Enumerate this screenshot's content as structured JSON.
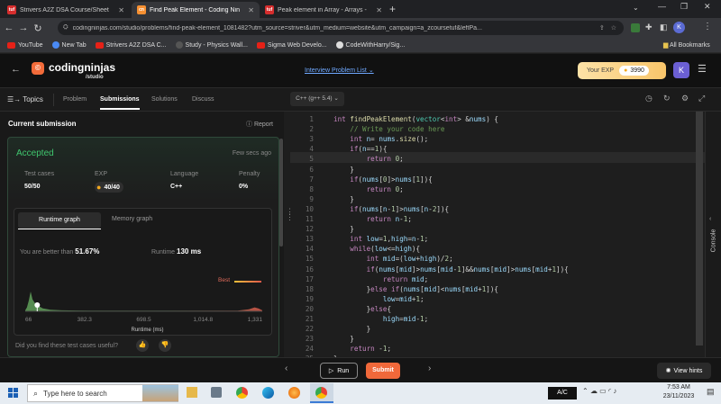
{
  "browser": {
    "tabs": [
      {
        "fav": "tuf",
        "title": "Strivers A2Z DSA Course/Sheet",
        "active": false
      },
      {
        "fav": "cn",
        "title": "Find Peak Element - Coding Nin",
        "active": true
      },
      {
        "fav": "tuf",
        "title": "Peak element in Array - Arrays -",
        "active": false
      }
    ],
    "url": "codingninjas.com/studio/problems/find-peak-element_1081482?utm_source=striver&utm_medium=website&utm_campaign=a_zcoursetuf&leftPa...",
    "profile_initial": "K",
    "bookmarks": [
      "YouTube",
      "New Tab",
      "Strivers A2Z DSA C...",
      "Study - Physics Wall...",
      "Sigma Web Develo...",
      "CodeWithHarry/Sig..."
    ],
    "all_bookmarks": "All Bookmarks"
  },
  "site": {
    "logo_name": "codingninjas",
    "logo_sub": "/studio",
    "nav_link": "Interview Problem List",
    "exp_label": "Your EXP",
    "exp_value": "3990",
    "avatar": "K"
  },
  "toolbar": {
    "topics": "Topics",
    "tabs": [
      "Problem",
      "Submissions",
      "Solutions",
      "Discuss"
    ],
    "language": "C++ (g++ 5.4)"
  },
  "submission": {
    "header": "Current submission",
    "report": "Report",
    "status": "Accepted",
    "time": "Few secs ago",
    "stats": [
      {
        "label": "Test cases",
        "value": "50/50"
      },
      {
        "label": "EXP",
        "value": "40/40"
      },
      {
        "label": "Language",
        "value": "C++"
      },
      {
        "label": "Penalty",
        "value": "0%"
      }
    ],
    "graph_tabs": [
      "Runtime graph",
      "Memory graph"
    ],
    "better_text": "You are better than",
    "better_value": "51.67%",
    "runtime_label": "Runtime",
    "runtime_value": "130 ms",
    "best_label": "Best",
    "feedback": "Did you find these test cases useful?"
  },
  "chart_data": {
    "type": "area",
    "title": "",
    "xlabel": "Runtime (ms)",
    "ylabel": "",
    "x_ticks": [
      "66",
      "382.3",
      "698.5",
      "1,014.8",
      "1,331"
    ],
    "xlim": [
      66,
      1331
    ],
    "series": [
      {
        "name": "",
        "x": [
          66,
          75,
          85,
          95,
          105,
          115,
          125,
          130,
          140,
          160,
          200,
          260,
          340,
          420,
          520,
          620,
          720,
          820,
          920,
          1020,
          1120,
          1200,
          1260,
          1290,
          1310,
          1320,
          1331
        ],
        "values": [
          0.05,
          0.2,
          0.55,
          1.0,
          0.6,
          0.45,
          0.35,
          0.32,
          0.25,
          0.15,
          0.08,
          0.05,
          0.04,
          0.03,
          0.03,
          0.03,
          0.03,
          0.03,
          0.03,
          0.03,
          0.03,
          0.03,
          0.1,
          0.2,
          0.15,
          0.1,
          0.05
        ]
      }
    ],
    "marker_x": 130
  },
  "editor": {
    "lines": [
      "int findPeakElement(vector<int> &nums) {",
      "    // Write your code here",
      "    int n= nums.size();",
      "    if(n==1){",
      "        return 0;",
      "    }",
      "    if(nums[0]>nums[1]){",
      "        return 0;",
      "    }",
      "    if(nums[n-1]>nums[n-2]){",
      "        return n-1;",
      "    }",
      "    int low=1,high=n-1;",
      "    while(low<=high){",
      "        int mid=(low+high)/2;",
      "        if(nums[mid]>nums[mid-1]&&nums[mid]>nums[mid+1]){",
      "            return mid;",
      "        }else if(nums[mid]<nums[mid+1]){",
      "            low=mid+1;",
      "        }else{",
      "            high=mid-1;",
      "        }",
      "    }",
      "    return -1;",
      "}"
    ],
    "console_label": "Console"
  },
  "bottom": {
    "run": "Run",
    "submit": "Submit",
    "hints": "View hints"
  },
  "taskbar": {
    "search_placeholder": "Type here to search",
    "ac_label": "A/C",
    "time": "7:53 AM",
    "date": "23/11/2023"
  }
}
